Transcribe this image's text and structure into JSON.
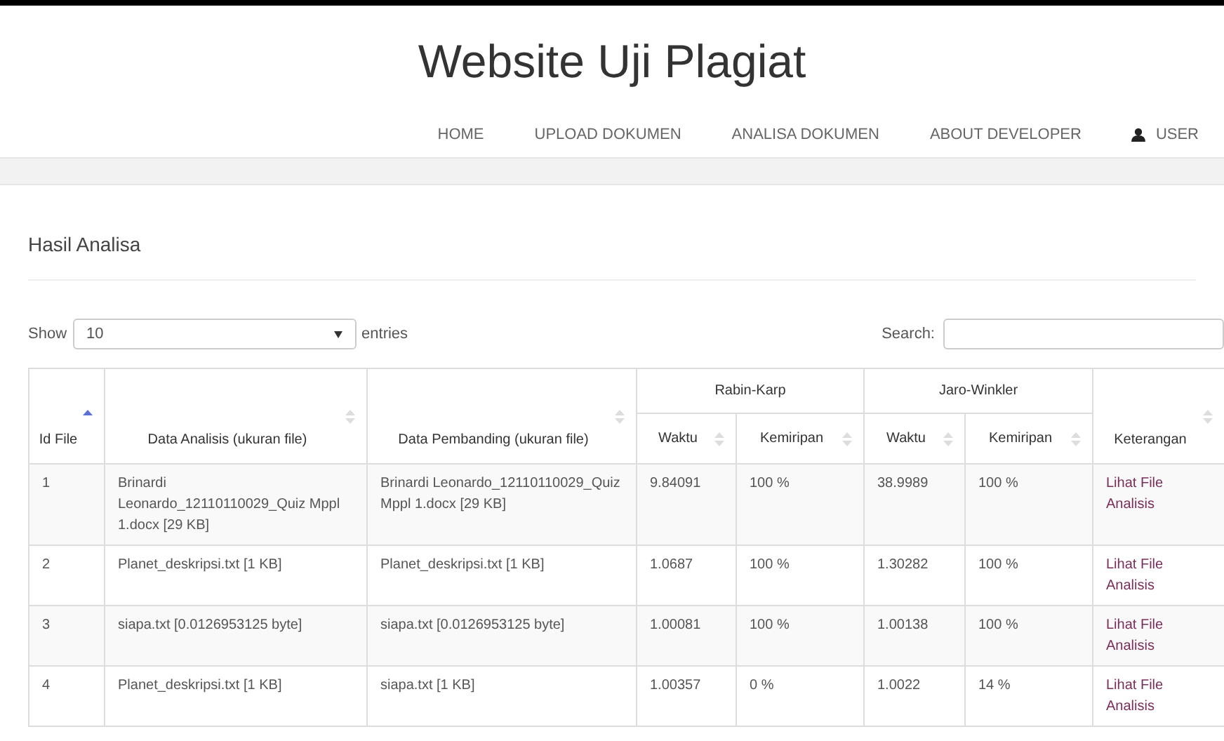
{
  "site_title": "Website Uji Plagiat",
  "nav": [
    {
      "label": "HOME",
      "kind": "link"
    },
    {
      "label": "UPLOAD DOKUMEN",
      "kind": "link"
    },
    {
      "label": "ANALISA DOKUMEN",
      "kind": "link"
    },
    {
      "label": "ABOUT DEVELOPER",
      "kind": "link"
    },
    {
      "label": "USER",
      "kind": "user"
    }
  ],
  "section_title": "Hasil Analisa",
  "length_control": {
    "prefix": "Show",
    "value": "10",
    "suffix": "entries"
  },
  "search": {
    "label": "Search:"
  },
  "table": {
    "column_groups": [
      {
        "label": "Rabin-Karp"
      },
      {
        "label": "Jaro-Winkler"
      }
    ],
    "columns": [
      {
        "label": "Id File",
        "sorted_ascending": true
      },
      {
        "label": "Data Analisis (ukuran file)",
        "sorted_ascending": false
      },
      {
        "label": "Data Pembanding (ukuran file)",
        "sorted_ascending": false
      },
      {
        "label": "Waktu",
        "sorted_ascending": false
      },
      {
        "label": "Kemiripan",
        "sorted_ascending": false
      },
      {
        "label": "Waktu",
        "sorted_ascending": false
      },
      {
        "label": "Kemiripan",
        "sorted_ascending": false
      },
      {
        "label": "Keterangan",
        "sorted_ascending": false
      }
    ],
    "rows": [
      {
        "cells": [
          "1",
          "Brinardi Leonardo_12110110029_Quiz Mppl 1.docx [29 KB]",
          "Brinardi Leonardo_12110110029_Quiz Mppl 1.docx [29 KB]",
          "9.84091",
          "100 %",
          "38.9989",
          "100 %"
        ],
        "link": "Lihat File Analisis"
      },
      {
        "cells": [
          "2",
          "Planet_deskripsi.txt [1 KB]",
          "Planet_deskripsi.txt [1 KB]",
          "1.0687",
          "100 %",
          "1.30282",
          "100 %"
        ],
        "link": "Lihat File Analisis"
      },
      {
        "cells": [
          "3",
          "siapa.txt [0.0126953125 byte]",
          "siapa.txt [0.0126953125 byte]",
          "1.00081",
          "100 %",
          "1.00138",
          "100 %"
        ],
        "link": "Lihat File Analisis"
      },
      {
        "cells": [
          "4",
          "Planet_deskripsi.txt [1 KB]",
          "siapa.txt [1 KB]",
          "1.00357",
          "0 %",
          "1.0022",
          "14 %"
        ],
        "link": "Lihat File Analisis"
      }
    ]
  }
}
